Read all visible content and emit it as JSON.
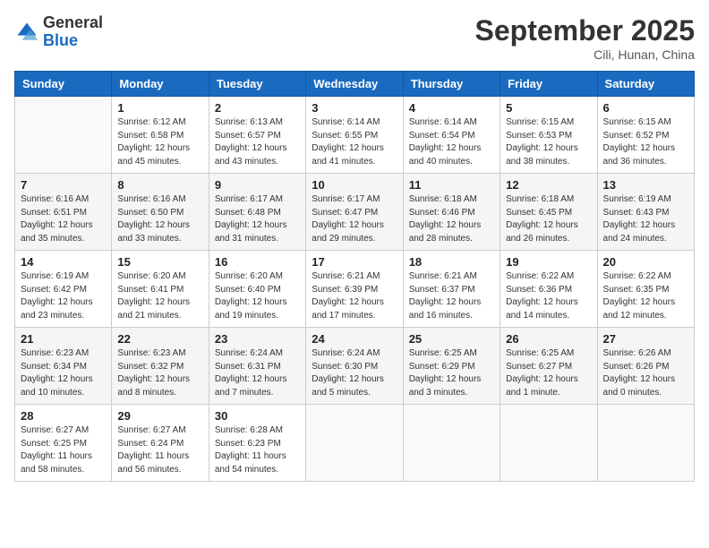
{
  "header": {
    "logo_general": "General",
    "logo_blue": "Blue",
    "month": "September 2025",
    "location": "Cili, Hunan, China"
  },
  "weekdays": [
    "Sunday",
    "Monday",
    "Tuesday",
    "Wednesday",
    "Thursday",
    "Friday",
    "Saturday"
  ],
  "weeks": [
    [
      {
        "day": "",
        "info": ""
      },
      {
        "day": "1",
        "info": "Sunrise: 6:12 AM\nSunset: 6:58 PM\nDaylight: 12 hours\nand 45 minutes."
      },
      {
        "day": "2",
        "info": "Sunrise: 6:13 AM\nSunset: 6:57 PM\nDaylight: 12 hours\nand 43 minutes."
      },
      {
        "day": "3",
        "info": "Sunrise: 6:14 AM\nSunset: 6:55 PM\nDaylight: 12 hours\nand 41 minutes."
      },
      {
        "day": "4",
        "info": "Sunrise: 6:14 AM\nSunset: 6:54 PM\nDaylight: 12 hours\nand 40 minutes."
      },
      {
        "day": "5",
        "info": "Sunrise: 6:15 AM\nSunset: 6:53 PM\nDaylight: 12 hours\nand 38 minutes."
      },
      {
        "day": "6",
        "info": "Sunrise: 6:15 AM\nSunset: 6:52 PM\nDaylight: 12 hours\nand 36 minutes."
      }
    ],
    [
      {
        "day": "7",
        "info": "Sunrise: 6:16 AM\nSunset: 6:51 PM\nDaylight: 12 hours\nand 35 minutes."
      },
      {
        "day": "8",
        "info": "Sunrise: 6:16 AM\nSunset: 6:50 PM\nDaylight: 12 hours\nand 33 minutes."
      },
      {
        "day": "9",
        "info": "Sunrise: 6:17 AM\nSunset: 6:48 PM\nDaylight: 12 hours\nand 31 minutes."
      },
      {
        "day": "10",
        "info": "Sunrise: 6:17 AM\nSunset: 6:47 PM\nDaylight: 12 hours\nand 29 minutes."
      },
      {
        "day": "11",
        "info": "Sunrise: 6:18 AM\nSunset: 6:46 PM\nDaylight: 12 hours\nand 28 minutes."
      },
      {
        "day": "12",
        "info": "Sunrise: 6:18 AM\nSunset: 6:45 PM\nDaylight: 12 hours\nand 26 minutes."
      },
      {
        "day": "13",
        "info": "Sunrise: 6:19 AM\nSunset: 6:43 PM\nDaylight: 12 hours\nand 24 minutes."
      }
    ],
    [
      {
        "day": "14",
        "info": "Sunrise: 6:19 AM\nSunset: 6:42 PM\nDaylight: 12 hours\nand 23 minutes."
      },
      {
        "day": "15",
        "info": "Sunrise: 6:20 AM\nSunset: 6:41 PM\nDaylight: 12 hours\nand 21 minutes."
      },
      {
        "day": "16",
        "info": "Sunrise: 6:20 AM\nSunset: 6:40 PM\nDaylight: 12 hours\nand 19 minutes."
      },
      {
        "day": "17",
        "info": "Sunrise: 6:21 AM\nSunset: 6:39 PM\nDaylight: 12 hours\nand 17 minutes."
      },
      {
        "day": "18",
        "info": "Sunrise: 6:21 AM\nSunset: 6:37 PM\nDaylight: 12 hours\nand 16 minutes."
      },
      {
        "day": "19",
        "info": "Sunrise: 6:22 AM\nSunset: 6:36 PM\nDaylight: 12 hours\nand 14 minutes."
      },
      {
        "day": "20",
        "info": "Sunrise: 6:22 AM\nSunset: 6:35 PM\nDaylight: 12 hours\nand 12 minutes."
      }
    ],
    [
      {
        "day": "21",
        "info": "Sunrise: 6:23 AM\nSunset: 6:34 PM\nDaylight: 12 hours\nand 10 minutes."
      },
      {
        "day": "22",
        "info": "Sunrise: 6:23 AM\nSunset: 6:32 PM\nDaylight: 12 hours\nand 8 minutes."
      },
      {
        "day": "23",
        "info": "Sunrise: 6:24 AM\nSunset: 6:31 PM\nDaylight: 12 hours\nand 7 minutes."
      },
      {
        "day": "24",
        "info": "Sunrise: 6:24 AM\nSunset: 6:30 PM\nDaylight: 12 hours\nand 5 minutes."
      },
      {
        "day": "25",
        "info": "Sunrise: 6:25 AM\nSunset: 6:29 PM\nDaylight: 12 hours\nand 3 minutes."
      },
      {
        "day": "26",
        "info": "Sunrise: 6:25 AM\nSunset: 6:27 PM\nDaylight: 12 hours\nand 1 minute."
      },
      {
        "day": "27",
        "info": "Sunrise: 6:26 AM\nSunset: 6:26 PM\nDaylight: 12 hours\nand 0 minutes."
      }
    ],
    [
      {
        "day": "28",
        "info": "Sunrise: 6:27 AM\nSunset: 6:25 PM\nDaylight: 11 hours\nand 58 minutes."
      },
      {
        "day": "29",
        "info": "Sunrise: 6:27 AM\nSunset: 6:24 PM\nDaylight: 11 hours\nand 56 minutes."
      },
      {
        "day": "30",
        "info": "Sunrise: 6:28 AM\nSunset: 6:23 PM\nDaylight: 11 hours\nand 54 minutes."
      },
      {
        "day": "",
        "info": ""
      },
      {
        "day": "",
        "info": ""
      },
      {
        "day": "",
        "info": ""
      },
      {
        "day": "",
        "info": ""
      }
    ]
  ]
}
